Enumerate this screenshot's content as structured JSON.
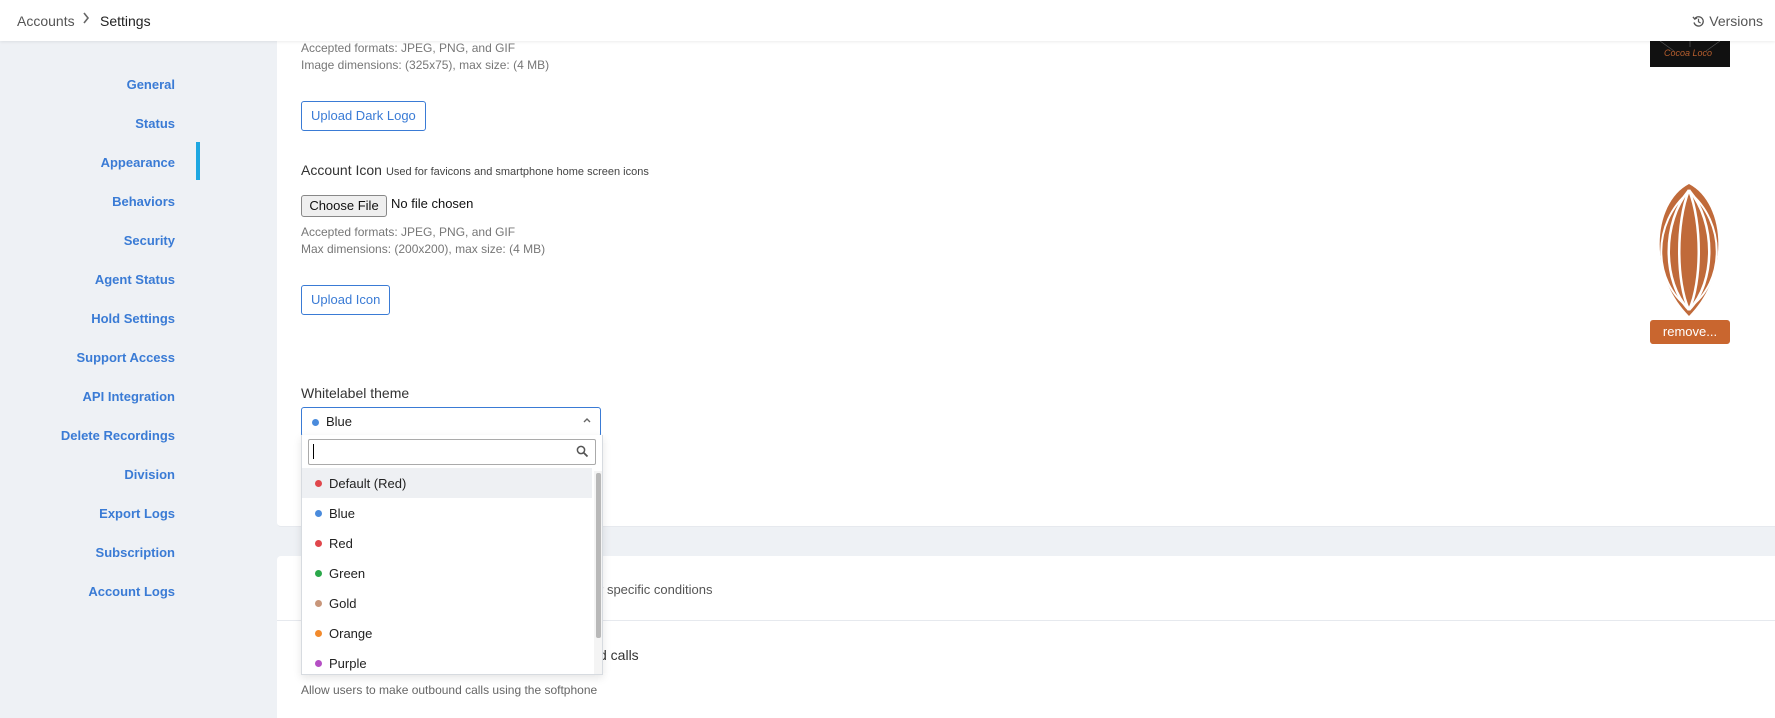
{
  "header": {
    "breadcrumb": [
      "Accounts",
      "Settings"
    ],
    "versions_label": "Versions"
  },
  "sidebar": {
    "items": [
      {
        "label": "General"
      },
      {
        "label": "Status"
      },
      {
        "label": "Appearance",
        "active": true
      },
      {
        "label": "Behaviors"
      },
      {
        "label": "Security"
      },
      {
        "label": "Agent Status"
      },
      {
        "label": "Hold Settings"
      },
      {
        "label": "Support Access"
      },
      {
        "label": "API Integration"
      },
      {
        "label": "Delete Recordings"
      },
      {
        "label": "Division"
      },
      {
        "label": "Export Logs"
      },
      {
        "label": "Subscription"
      },
      {
        "label": "Account Logs"
      }
    ]
  },
  "dark_logo": {
    "formats": "Accepted formats: JPEG, PNG, and GIF",
    "dimensions": "Image dimensions: (325x75), max size: (4 MB)",
    "upload_label": "Upload Dark Logo",
    "preview_text": "Cocoa Loco"
  },
  "account_icon": {
    "label": "Account Icon",
    "hint": "Used for favicons and smartphone home screen icons",
    "choose_file_label": "Choose File",
    "file_status": "No file chosen",
    "formats": "Accepted formats: JPEG, PNG, and GIF",
    "dimensions": "Max dimensions: (200x200), max size: (4 MB)",
    "upload_label": "Upload Icon",
    "remove_label": "remove..."
  },
  "whitelabel_theme": {
    "label": "Whitelabel theme",
    "selected": "Blue",
    "selected_color": "#4a8bdc",
    "search_placeholder": "",
    "options": [
      {
        "label": "Default (Red)",
        "color": "#e0474c",
        "highlighted": true
      },
      {
        "label": "Blue",
        "color": "#4a8bdc"
      },
      {
        "label": "Red",
        "color": "#e0474c"
      },
      {
        "label": "Green",
        "color": "#2aa84a"
      },
      {
        "label": "Gold",
        "color": "#c8967a"
      },
      {
        "label": "Orange",
        "color": "#f28a2c"
      },
      {
        "label": "Purple",
        "color": "#b54fc4"
      }
    ]
  },
  "behaviors_partial": {
    "text1": "r specific conditions",
    "text2": "d calls",
    "text3": "Allow users to make outbound calls using the softphone"
  }
}
